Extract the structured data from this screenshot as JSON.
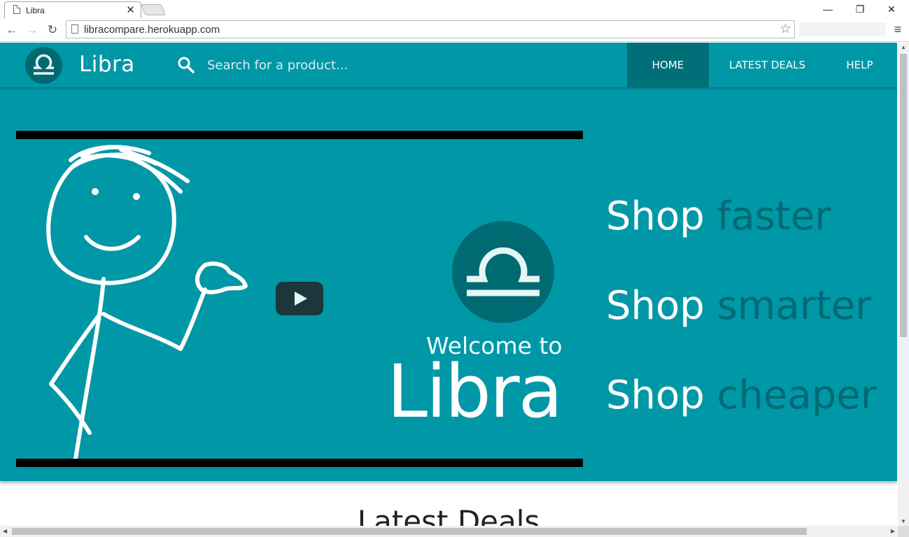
{
  "browser": {
    "tab_title": "Libra",
    "tab_close": "✕",
    "url": "libracompare.herokuapp.com",
    "back": "←",
    "forward": "→",
    "reload": "↻",
    "star": "☆",
    "menu": "≡",
    "minimize": "—",
    "restore": "❐",
    "close": "✕"
  },
  "navbar": {
    "brand": "Libra",
    "search_placeholder": "Search for a product...",
    "links": [
      "HOME",
      "LATEST DEALS",
      "HELP"
    ],
    "active_link": "HOME"
  },
  "hero": {
    "video": {
      "welcome_text": "Welcome to",
      "brand_text": "Libra"
    },
    "taglines": [
      {
        "word": "Shop",
        "accent": "faster"
      },
      {
        "word": "Shop",
        "accent": "smarter"
      },
      {
        "word": "Shop",
        "accent": "cheaper"
      }
    ]
  },
  "sections": {
    "latest_deals_title": "Latest Deals"
  },
  "colors": {
    "primary": "#0097a7",
    "primary_dark": "#006a73",
    "nav_active": "#006f78"
  }
}
